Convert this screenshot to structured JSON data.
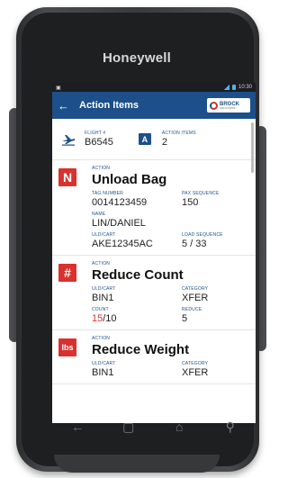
{
  "device": {
    "brand": "Honeywell"
  },
  "status": {
    "time": "10:30"
  },
  "appbar": {
    "back_glyph": "←",
    "title": "Action Items",
    "logo_text": "BROCK",
    "logo_sub": "SOLUTIONS"
  },
  "flight": {
    "flight_label": "FLIGHT #",
    "flight_value": "B6545",
    "badge": "A",
    "items_label": "ACTION ITEMS",
    "items_value": "2"
  },
  "items": [
    {
      "icon": "N",
      "action_label": "ACTION",
      "title": "Unload Bag",
      "fields": [
        {
          "label": "TAG NUMBER",
          "value": "0014123459"
        },
        {
          "label": "PAX SEQUENCE",
          "value": "150"
        },
        {
          "label": "NAME",
          "value": "LIN/DANIEL"
        },
        {
          "label": "",
          "value": ""
        },
        {
          "label": "ULD/CART",
          "value": "AKE12345AC"
        },
        {
          "label": "LOAD SEQUENCE",
          "value": "5 / 33"
        }
      ]
    },
    {
      "icon": "#",
      "action_label": "ACTION",
      "title": "Reduce Count",
      "fields": [
        {
          "label": "ULD/CART",
          "value": "BIN1"
        },
        {
          "label": "CATEGORY",
          "value": "XFER"
        },
        {
          "label": "COUNT",
          "value_red": "15",
          "value_rest": "/10"
        },
        {
          "label": "REDUCE",
          "value": "5"
        }
      ]
    },
    {
      "icon": "lbs",
      "action_label": "ACTION",
      "title": "Reduce Weight",
      "fields": [
        {
          "label": "ULD/CART",
          "value": "BIN1"
        },
        {
          "label": "CATEGORY",
          "value": "XFER"
        }
      ]
    }
  ],
  "nav": {
    "back": "←",
    "recent": "▢",
    "home": "⌂",
    "search": "⚲"
  },
  "colors": {
    "accent": "#1d4f8a",
    "alert": "#d9322e"
  }
}
